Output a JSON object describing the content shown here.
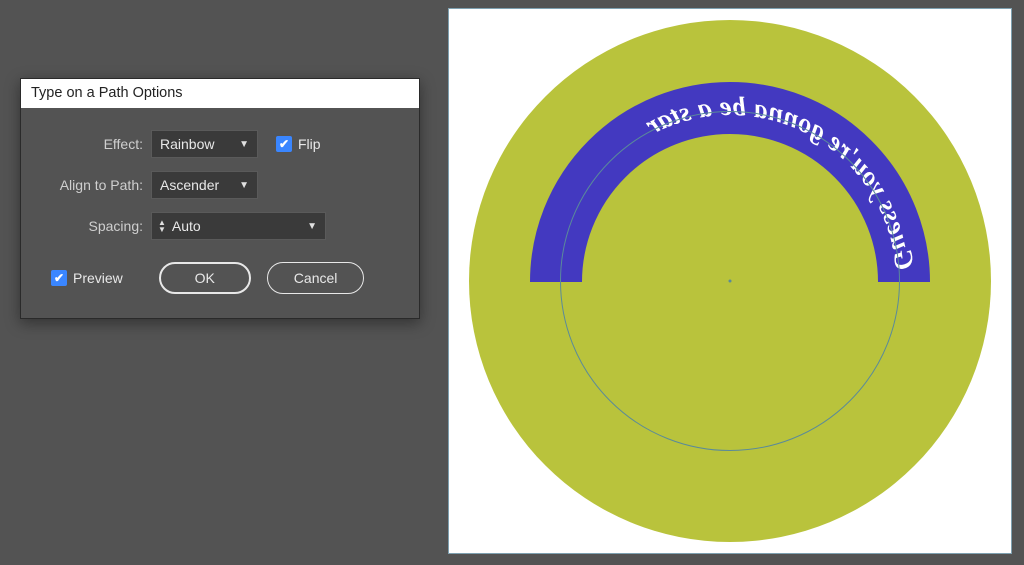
{
  "dialog": {
    "title": "Type on a Path Options",
    "effect_label": "Effect:",
    "effect_value": "Rainbow",
    "flip_label": "Flip",
    "flip_checked": true,
    "align_label": "Align to Path:",
    "align_value": "Ascender",
    "spacing_label": "Spacing:",
    "spacing_value": "Auto",
    "preview_label": "Preview",
    "preview_checked": true,
    "ok_label": "OK",
    "cancel_label": "Cancel"
  },
  "canvas": {
    "path_text": "Guess you're gonna be a star",
    "colors": {
      "circle_fill": "#b9c33c",
      "arc_fill": "#4339c0",
      "text_fill": "#ffffff",
      "guide": "#5a8a9a"
    }
  }
}
